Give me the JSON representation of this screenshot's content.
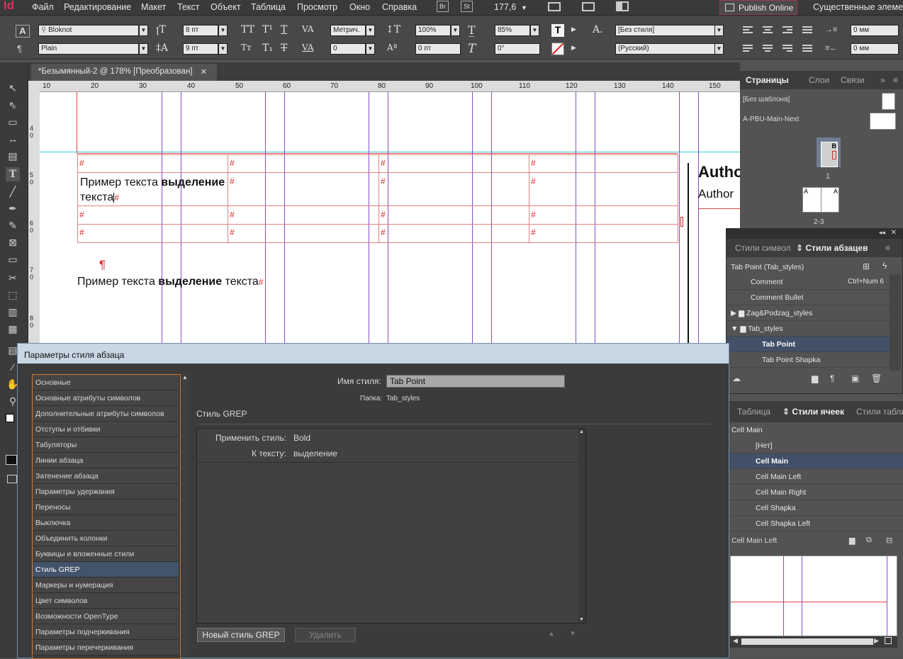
{
  "menu": {
    "app_icon": "Id",
    "items": [
      "Файл",
      "Редактирование",
      "Макет",
      "Текст",
      "Объект",
      "Таблица",
      "Просмотр",
      "Окно",
      "Справка"
    ],
    "br": "Br",
    "st": "St",
    "zoom": "177,6",
    "publish": "Publish Online",
    "workspace": "Существенные элемент"
  },
  "control": {
    "font_family": "Bloknot",
    "font_style": "Plain",
    "font_size": "8 пт",
    "leading": "9 пт",
    "kerning": "Метрич.",
    "tracking": "0",
    "vscale": "100%",
    "baseline": "0 пт",
    "hscale": "85%",
    "skew": "0°",
    "char_style": "[Без стиля]",
    "language": "(Русский)",
    "indent_left": "0 мм",
    "indent_right": "0 мм"
  },
  "doc_tab": {
    "title": "*Безымянный-2 @ 178% [Преобразован]"
  },
  "ruler": {
    "h": [
      "10",
      "20",
      "30",
      "40",
      "50",
      "60",
      "70",
      "80",
      "90",
      "100",
      "110",
      "120",
      "130",
      "140",
      "150"
    ],
    "v": [
      "4 0",
      "5 0",
      "6 0",
      "7 0",
      "8 0"
    ]
  },
  "canvas": {
    "cell_text_line1": "Пример текста ",
    "cell_text_bold": "выделение",
    "cell_text_line2": "текста",
    "para_text_start": "Пример текста ",
    "para_text_bold": "выделение",
    "para_text_end": " текста",
    "hash": "#",
    "pilcrow": "¶",
    "author_bold": "Autho",
    "author": "Author"
  },
  "pages_panel": {
    "tabs": [
      "Страницы",
      "Слои",
      "Связи"
    ],
    "none_master": "[Без шаблона]",
    "master": "A-PBU-Main-Next",
    "page1": "1",
    "page1_letter": "B",
    "spread": "2-3",
    "spread_letter": "A"
  },
  "para_styles_panel": {
    "tabs": [
      "Стили символ",
      "Стили абзацев"
    ],
    "current": "Tab Point (Tab_styles)",
    "items": [
      {
        "name": "Comment",
        "shortcut": "Ctrl+Num 6"
      },
      {
        "name": "Comment Bullet",
        "shortcut": ""
      },
      {
        "name": "Zag&Podzag_styles",
        "shortcut": ""
      },
      {
        "name": "Tab_styles",
        "shortcut": ""
      },
      {
        "name": "Tab Point",
        "shortcut": ""
      },
      {
        "name": "Tab Point Shapka",
        "shortcut": ""
      }
    ]
  },
  "cell_styles_panel": {
    "tabs": [
      "Таблица",
      "Стили ячеек",
      "Стили табли"
    ],
    "current": "Cell Main",
    "items": [
      "[Нет]",
      "Cell Main",
      "Cell Main Left",
      "Cell Main Right",
      "Cell Shapka",
      "Cell Shapka Left"
    ],
    "footer": "Cell Main Left"
  },
  "dialog": {
    "title": "Параметры стиля абзаца",
    "categories": [
      "Основные",
      "Основные атрибуты символов",
      "Дополнительные атрибуты символов",
      "Отступы и отбивки",
      "Табуляторы",
      "Линии абзаца",
      "Затенение абзаца",
      "Параметры удержания",
      "Переносы",
      "Выключка",
      "Объединить колонки",
      "Буквицы и вложенные стили",
      "Стиль GREP",
      "Маркеры и нумерация",
      "Цвет символов",
      "Возможности OpenType",
      "Параметры подчеркивания",
      "Параметры перечеркивания"
    ],
    "style_name_label": "Имя стиля:",
    "style_name": "Tab Point",
    "folder_label": "Папка:",
    "folder": "Tab_styles",
    "section": "Стиль GREP",
    "apply_label": "Применить стиль:",
    "apply_value": "Bold",
    "to_text_label": "К тексту:",
    "to_text_value": "выделение",
    "new_grep": "Новый стиль GREP",
    "delete": "Удалить"
  },
  "colors": {
    "selection": "#425068",
    "guide": "#8a4bc8",
    "cell_border": "#e28080",
    "hash": "#d32a2a",
    "dialog_border": "#d2782f"
  }
}
